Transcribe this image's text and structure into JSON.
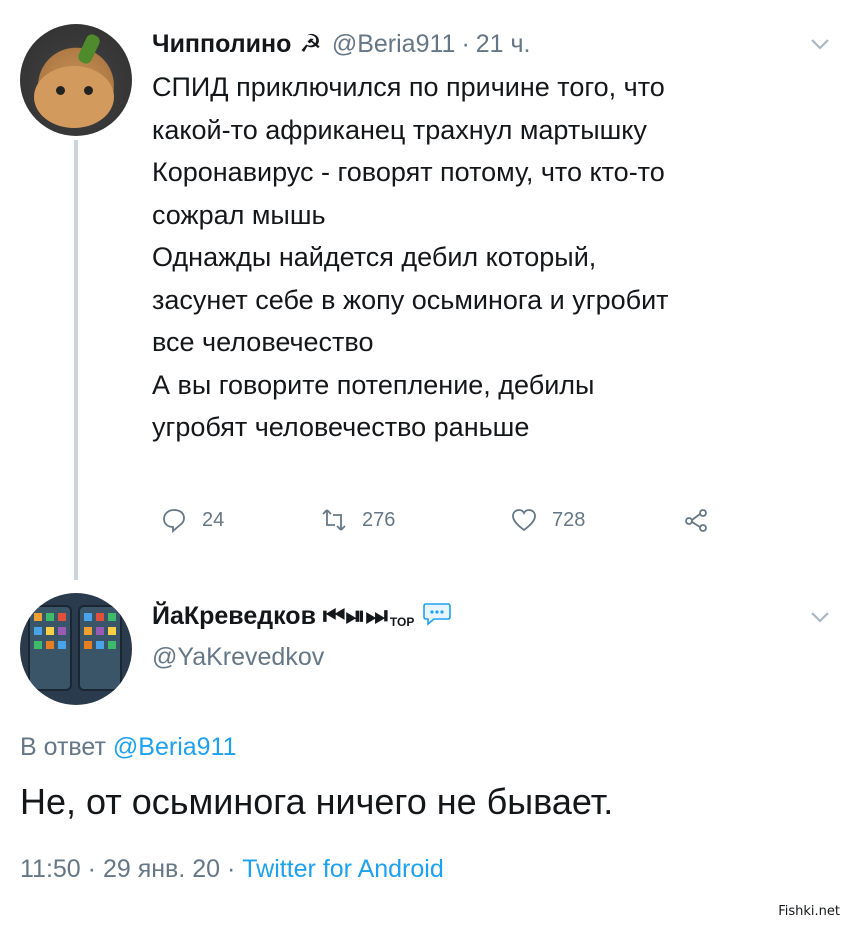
{
  "tweet": {
    "author_name": "Чипполино",
    "author_symbol": "☭",
    "author_handle": "@Beria911",
    "time_sep": "·",
    "time": "21 ч.",
    "lines": [
      "СПИД приключился  по причине того, что",
      "какой-то африканец трахнул мартышку",
      "Коронавирус - говорят потому, что кто-то",
      "сожрал мышь",
      "Однажды найдется дебил который,",
      "засунет себе в жопу осьминога и угробит",
      "все человечество",
      "А вы говорите потепление, дебилы",
      "угробят человечество раньше"
    ],
    "replies": "24",
    "retweets": "276",
    "likes": "728",
    "icons": {
      "reply": "reply-icon",
      "retweet": "retweet-icon",
      "like": "heart-icon",
      "share": "share-icon",
      "menu": "chevron-down-icon"
    }
  },
  "reply": {
    "author_name": "ЙаКреведков ⏮⏯⏭",
    "author_badge": "TOP",
    "author_handle": "@YaKrevedkov",
    "reply_prefix": "В ответ",
    "reply_mention": "@Beria911",
    "text": "Не, от осьминога ничего не бывает.",
    "time": "11:50",
    "date": "29 янв. 20",
    "sep": "·",
    "client": "Twitter for Android"
  },
  "watermark": "Fishki.net",
  "colors": {
    "accent": "#1da1f2",
    "muted": "#657786",
    "text": "#14171a",
    "thread_line": "#cdd5dc"
  }
}
